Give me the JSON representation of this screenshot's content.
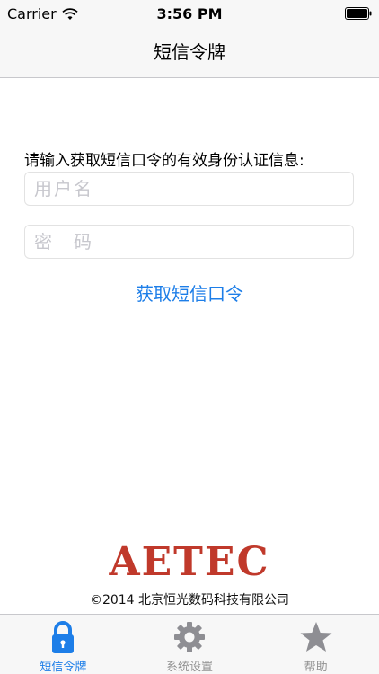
{
  "status_bar": {
    "carrier": "Carrier",
    "time": "3:56 PM",
    "wifi_icon": "wifi-icon",
    "battery_icon": "battery-icon"
  },
  "nav": {
    "title": "短信令牌"
  },
  "form": {
    "prompt": "请输入获取短信口令的有效身份认证信息:",
    "username": {
      "value": "",
      "placeholder": "用户名"
    },
    "password": {
      "value": "",
      "placeholder": "密　码"
    },
    "get_code_label": "获取短信口令"
  },
  "footer": {
    "logo": "AETEC",
    "copyright": "©2014  北京恒光数码科技有限公司"
  },
  "tabbar": {
    "active_color": "#1d7ee8",
    "inactive_color": "#929292",
    "tabs": [
      {
        "label": "短信令牌",
        "icon": "lock-icon",
        "active": true
      },
      {
        "label": "系统设置",
        "icon": "gear-icon",
        "active": false
      },
      {
        "label": "帮助",
        "icon": "star-icon",
        "active": false
      }
    ]
  },
  "colors": {
    "accent": "#1d7ee8",
    "logo": "#c0392b"
  }
}
